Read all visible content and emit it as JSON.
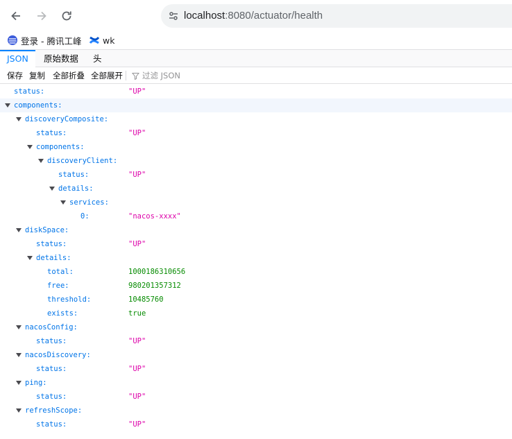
{
  "browser": {
    "url_host": "localhost",
    "url_rest": ":8080/actuator/health",
    "icons": {
      "back": "arrow-left-icon",
      "forward": "arrow-right-icon",
      "reload": "reload-icon",
      "site_info": "site-info-icon"
    }
  },
  "bookmarks": [
    {
      "label": "登录 - 腾讯工峰",
      "icon": "tencent-icon"
    },
    {
      "label": "wk",
      "icon": "confluence-icon"
    }
  ],
  "viewer": {
    "tabs": [
      "JSON",
      "原始数据",
      "头"
    ],
    "actions": {
      "save": "保存",
      "copy": "复制",
      "collapse_all": "全部折叠",
      "expand_all": "全部展开"
    },
    "filter_placeholder": "过滤 JSON"
  },
  "tree": [
    {
      "key": "status:",
      "value": "\"UP\"",
      "type": "str"
    },
    {
      "key": "components:",
      "expandable": true
    },
    {
      "key": "discoveryComposite:",
      "expandable": true
    },
    {
      "key": "status:",
      "value": "\"UP\"",
      "type": "str"
    },
    {
      "key": "components:",
      "expandable": true
    },
    {
      "key": "discoveryClient:",
      "expandable": true
    },
    {
      "key": "status:",
      "value": "\"UP\"",
      "type": "str"
    },
    {
      "key": "details:",
      "expandable": true
    },
    {
      "key": "services:",
      "expandable": true
    },
    {
      "key": "0:",
      "value": "\"nacos-xxxx\"",
      "type": "str"
    },
    {
      "key": "diskSpace:",
      "expandable": true
    },
    {
      "key": "status:",
      "value": "\"UP\"",
      "type": "str"
    },
    {
      "key": "details:",
      "expandable": true
    },
    {
      "key": "total:",
      "value": "1000186310656",
      "type": "num"
    },
    {
      "key": "free:",
      "value": "980201357312",
      "type": "num"
    },
    {
      "key": "threshold:",
      "value": "10485760",
      "type": "num"
    },
    {
      "key": "exists:",
      "value": "true",
      "type": "bool"
    },
    {
      "key": "nacosConfig:",
      "expandable": true
    },
    {
      "key": "status:",
      "value": "\"UP\"",
      "type": "str"
    },
    {
      "key": "nacosDiscovery:",
      "expandable": true
    },
    {
      "key": "status:",
      "value": "\"UP\"",
      "type": "str"
    },
    {
      "key": "ping:",
      "expandable": true
    },
    {
      "key": "status:",
      "value": "\"UP\"",
      "type": "str"
    },
    {
      "key": "refreshScope:",
      "expandable": true
    },
    {
      "key": "status:",
      "value": "\"UP\"",
      "type": "str"
    }
  ],
  "colors": {
    "key": "#0074e8",
    "string": "#dd00a9",
    "number": "#058b00",
    "accent": "#0a84ff"
  }
}
